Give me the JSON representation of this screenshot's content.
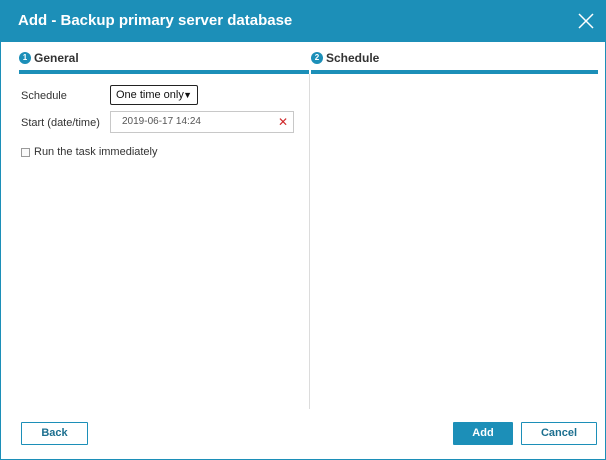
{
  "dialog": {
    "title": "Add - Backup primary server database",
    "accent_color": "#1c8fb8",
    "close_icon": "close-icon"
  },
  "steps": [
    {
      "number": "1",
      "label": "General"
    },
    {
      "number": "2",
      "label": "Schedule"
    }
  ],
  "form": {
    "schedule_label": "Schedule",
    "schedule_value": "One time only",
    "start_label": "Start (date/time)",
    "start_value": "2019-06-17 14:24",
    "run_immediately_label": "Run the task immediately",
    "run_immediately_checked": false
  },
  "footer": {
    "back_label": "Back",
    "add_label": "Add",
    "cancel_label": "Cancel"
  }
}
